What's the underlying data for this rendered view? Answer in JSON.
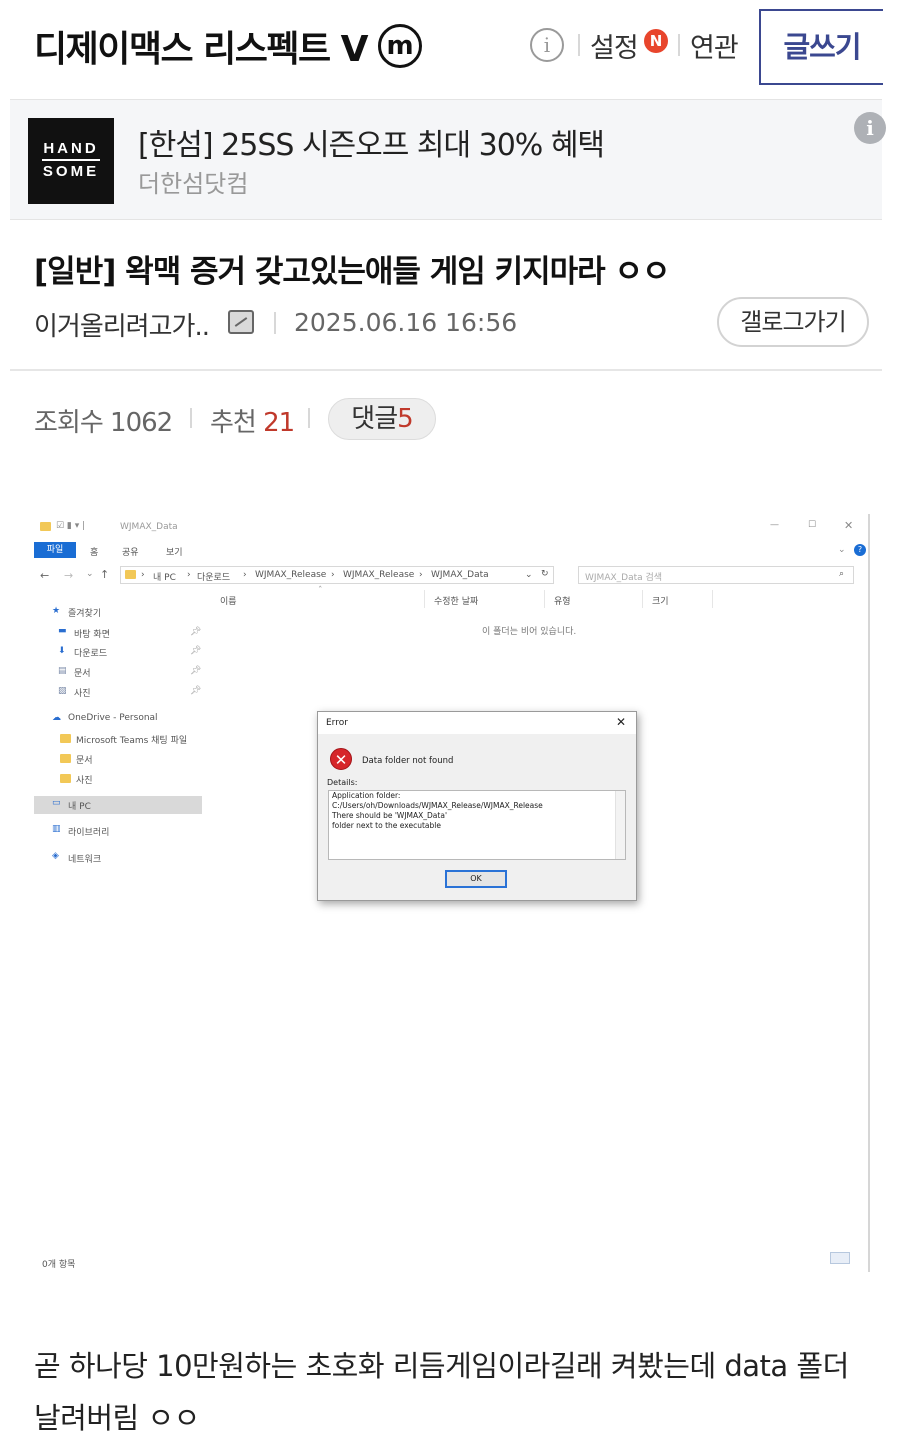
{
  "header": {
    "gallery_title": "디제이맥스 리스펙트 V",
    "minor_badge": "m",
    "info_icon": "i",
    "settings_label": "설정",
    "new_badge": "N",
    "related_label": "연관",
    "write_label": "글쓰기"
  },
  "ad": {
    "logo_line1": "HAND",
    "logo_line2": "SOME",
    "title": "[한섬] 25SS 시즌오프 최대 30% 혜택",
    "source": "더한섬닷컴",
    "info_icon": "i"
  },
  "post": {
    "title": "[일반] 왁맥 증거 갖고있는애들 게임 키지마라 ㅇㅇ",
    "author": "이거올리려고가..",
    "date": "2025.06.16 16:56",
    "gallery_button": "갤로그가기",
    "views_label": "조회수",
    "views": "1062",
    "recommend_label": "추천",
    "recommend": "21",
    "comments_label": "댓글",
    "comments": "5",
    "body": "곧 하나당 10만원하는 초호화 리듬게임이라길래 켜봤는데 data 폴더 날려버림 ㅇㅇ"
  },
  "screenshot": {
    "window_title": "WJMAX_Data",
    "ribbon": {
      "file": "파일",
      "home": "홈",
      "share": "공유",
      "view": "보기"
    },
    "address": [
      "내 PC",
      "다운로드",
      "WJMAX_Release",
      "WJMAX_Release",
      "WJMAX_Data"
    ],
    "search_placeholder": "WJMAX_Data 검색",
    "columns": [
      "이름",
      "수정한 날짜",
      "유형",
      "크기"
    ],
    "empty_message": "이 폴더는 비어 있습니다.",
    "nav": {
      "quick_access": "즐겨찾기",
      "desktop": "바탕 화면",
      "downloads": "다운로드",
      "documents": "문서",
      "pictures": "사진",
      "onedrive": "OneDrive - Personal",
      "teams": "Microsoft Teams 채팅 파일",
      "od_documents": "문서",
      "od_pictures": "사진",
      "this_pc": "내 PC",
      "libraries": "라이브러리",
      "network": "네트워크"
    },
    "status": "0개 항목",
    "dialog": {
      "title": "Error",
      "message": "Data folder not found",
      "details_label": "Details:",
      "details": [
        "Application folder:",
        "C:/Users/oh/Downloads/WJMAX_Release/WJMAX_Release",
        "There should be 'WJMAX_Data'",
        "folder next to the executable"
      ],
      "ok": "OK"
    }
  }
}
